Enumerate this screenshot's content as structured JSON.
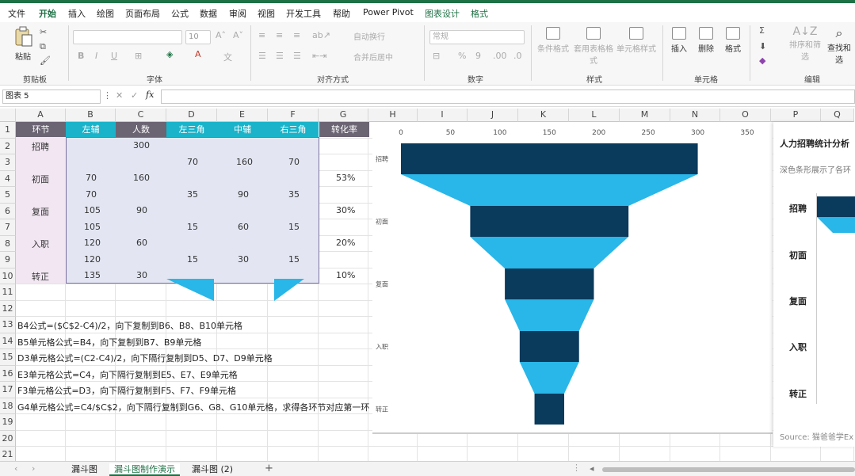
{
  "menu": [
    "文件",
    "开始",
    "插入",
    "绘图",
    "页面布局",
    "公式",
    "数据",
    "审阅",
    "视图",
    "开发工具",
    "帮助",
    "Power Pivot",
    "图表设计",
    "格式"
  ],
  "ribbon": {
    "paste": "粘贴",
    "clipboard": "剪贴板",
    "font": "字体",
    "font_size": "10",
    "align": "对齐方式",
    "wrap": "自动换行",
    "merge": "合并后居中",
    "number": "数字",
    "number_format": "常规",
    "styles": "样式",
    "cond_format": "条件格式",
    "table_format": "套用表格格式",
    "cell_style": "单元格样式",
    "cells": "单元格",
    "insert": "插入",
    "delete": "删除",
    "format": "格式",
    "editing": "编辑",
    "sort_filter": "排序和筛选",
    "find": "查找和选"
  },
  "formula_bar": {
    "name_box": "图表 5",
    "fx": "fx",
    "value": ""
  },
  "columns": [
    "A",
    "B",
    "C",
    "D",
    "E",
    "F",
    "G",
    "H",
    "I",
    "J",
    "K",
    "L",
    "M",
    "N",
    "O",
    "P",
    "Q"
  ],
  "rows": [
    "1",
    "2",
    "3",
    "4",
    "5",
    "6",
    "7",
    "8",
    "9",
    "10",
    "11",
    "12",
    "13",
    "14",
    "15",
    "16",
    "17",
    "18",
    "19",
    "20",
    "21"
  ],
  "table_headers": [
    "环节",
    "左辅",
    "人数",
    "左三角",
    "中辅",
    "右三角",
    "转化率"
  ],
  "stages": [
    "招聘",
    "初面",
    "复面",
    "入职",
    "转正"
  ],
  "cells": {
    "C2": "300",
    "D3": "70",
    "E3": "160",
    "F3": "70",
    "B4": "70",
    "C4": "160",
    "G4": "53%",
    "B5": "70",
    "D5": "35",
    "E5": "90",
    "F5": "35",
    "B6": "105",
    "C6": "90",
    "G6": "30%",
    "B7": "105",
    "D7": "15",
    "E7": "60",
    "F7": "15",
    "B8": "120",
    "C8": "60",
    "G8": "20%",
    "B9": "120",
    "D9": "15",
    "E9": "30",
    "F9": "15",
    "B10": "135",
    "C10": "30",
    "G10": "10%"
  },
  "notes": [
    "B4公式=($C$2-C4)/2，向下复制到B6、B8、B10单元格",
    "B5单元格公式=B4，向下复制到B7、B9单元格",
    "D3单元格公式=(C2-C4)/2，向下隔行复制到D5、D7、D9单元格",
    "E3单元格公式=C4，向下隔行复制到E5、E7、E9单元格",
    "F3单元格公式=D3，向下隔行复制到F5、F7、F9单元格",
    "G4单元格公式=C4/$C$2，向下隔行复制到G6、G8、G10单元格，求得各环节对应第一环"
  ],
  "chart_data": {
    "type": "bar",
    "orientation": "horizontal-stacked-funnel",
    "x_ticks": [
      "0",
      "50",
      "100",
      "150",
      "200",
      "250",
      "300",
      "350"
    ],
    "xlim": [
      0,
      350
    ],
    "categories": [
      "招聘",
      "初面",
      "复面",
      "入职",
      "转正"
    ],
    "category_labels": [
      "招聘",
      "初面",
      "复面",
      "入职",
      "转正"
    ],
    "values": [
      300,
      160,
      90,
      60,
      30
    ],
    "offsets": [
      0,
      70,
      105,
      120,
      135
    ],
    "connectors": [
      {
        "from": [
          0,
          300
        ],
        "to": [
          70,
          230
        ]
      },
      {
        "from": [
          70,
          230
        ],
        "to": [
          105,
          195
        ]
      },
      {
        "from": [
          105,
          195
        ],
        "to": [
          120,
          180
        ]
      },
      {
        "from": [
          120,
          180
        ],
        "to": [
          135,
          165
        ]
      }
    ],
    "colors": {
      "bar": "#0a3a5c",
      "connector": "#29b6e8"
    }
  },
  "chart2": {
    "title": "人力招聘统计分析",
    "subtitle": "深色条形展示了各环",
    "labels": [
      "招聘",
      "初面",
      "复面",
      "入职",
      "转正"
    ],
    "source": "Source: 猫爸爸学Ex"
  },
  "sheet_tabs": [
    "漏斗图",
    "漏斗图制作演示",
    "漏斗图 (2)"
  ],
  "colors": {
    "accent": "#1e7145",
    "table_header_teal": "#1ab3c9",
    "table_header_dark": "#6b6473",
    "table_fill": "#e3e6f2",
    "bar_dark": "#0a3a5c",
    "bar_light": "#29b6e8"
  }
}
